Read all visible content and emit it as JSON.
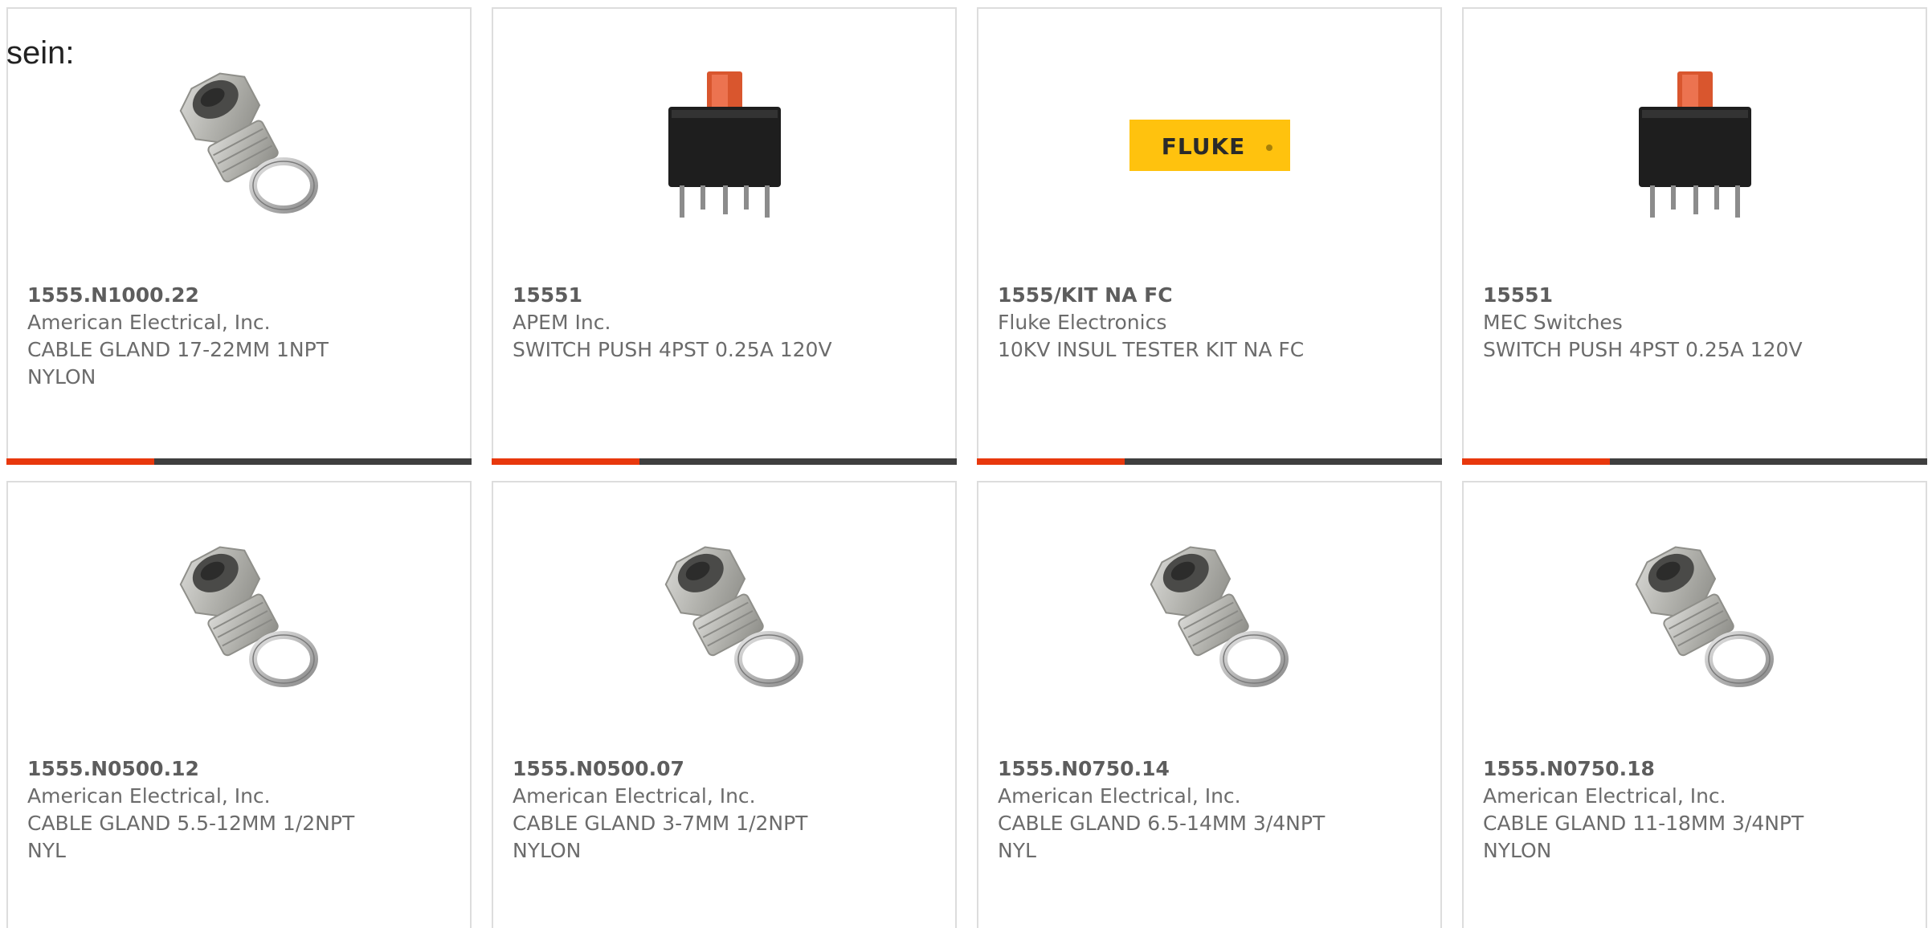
{
  "intro_text": "sein:",
  "colors": {
    "accent": "#e8380d",
    "bar": "#3f3f3f",
    "border": "#dddddd",
    "fluke_yellow": "#ffc20e"
  },
  "products": [
    {
      "part_number": "1555.N1000.22",
      "manufacturer": "American Electrical, Inc.",
      "description": "CABLE GLAND 17-22MM 1NPT NYLON",
      "image": "cable-gland-icon",
      "has_accent_bar": true
    },
    {
      "part_number": "15551",
      "manufacturer": "APEM Inc.",
      "description": "SWITCH PUSH 4PST 0.25A 120V",
      "image": "push-switch-icon",
      "has_accent_bar": true
    },
    {
      "part_number": "1555/KIT NA FC",
      "manufacturer": "Fluke Electronics",
      "description": "10KV INSUL TESTER KIT NA FC",
      "image": "fluke-logo",
      "logo_text": "FLUKE",
      "has_accent_bar": true
    },
    {
      "part_number": "15551",
      "manufacturer": "MEC Switches",
      "description": "SWITCH PUSH 4PST 0.25A 120V",
      "image": "push-switch-icon",
      "has_accent_bar": true
    },
    {
      "part_number": "1555.N0500.12",
      "manufacturer": "American Electrical, Inc.",
      "description": "CABLE GLAND 5.5-12MM 1/2NPT NYL",
      "image": "cable-gland-icon",
      "has_accent_bar": false
    },
    {
      "part_number": "1555.N0500.07",
      "manufacturer": "American Electrical, Inc.",
      "description": "CABLE GLAND 3-7MM 1/2NPT NYLON",
      "image": "cable-gland-icon",
      "has_accent_bar": false
    },
    {
      "part_number": "1555.N0750.14",
      "manufacturer": "American Electrical, Inc.",
      "description": "CABLE GLAND 6.5-14MM 3/4NPT NYL",
      "image": "cable-gland-icon",
      "has_accent_bar": false
    },
    {
      "part_number": "1555.N0750.18",
      "manufacturer": "American Electrical, Inc.",
      "description": "CABLE GLAND 11-18MM 3/4NPT NYLON",
      "image": "cable-gland-icon",
      "has_accent_bar": false
    }
  ]
}
